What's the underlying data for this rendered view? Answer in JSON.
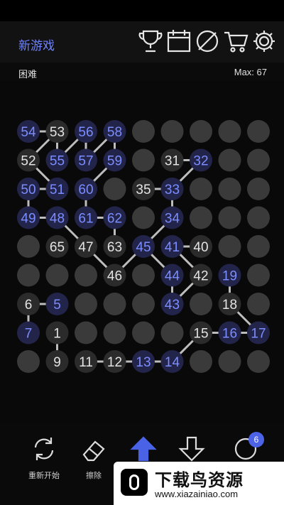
{
  "header": {
    "new_game": "新游戏",
    "icons": [
      "trophy-icon",
      "calendar-icon",
      "no-theme-icon",
      "cart-icon",
      "gear-icon"
    ]
  },
  "subheader": {
    "difficulty": "困难",
    "max": "Max: 67"
  },
  "board": {
    "rows": 9,
    "cols": 9,
    "colors": {
      "empty": "#3a3a3a",
      "given": "#2b2b2b",
      "placed": "#23244a",
      "given_text": "#e4e4e4",
      "placed_text": "#7b8dff",
      "line": "#bdbdbd"
    },
    "cells": [
      {
        "r": 0,
        "c": 0,
        "n": "54",
        "t": "p"
      },
      {
        "r": 0,
        "c": 1,
        "n": "53",
        "t": "g"
      },
      {
        "r": 0,
        "c": 2,
        "n": "56",
        "t": "p"
      },
      {
        "r": 0,
        "c": 3,
        "n": "58",
        "t": "p"
      },
      {
        "r": 1,
        "c": 0,
        "n": "52",
        "t": "g"
      },
      {
        "r": 1,
        "c": 1,
        "n": "55",
        "t": "p"
      },
      {
        "r": 1,
        "c": 2,
        "n": "57",
        "t": "p"
      },
      {
        "r": 1,
        "c": 3,
        "n": "59",
        "t": "p"
      },
      {
        "r": 1,
        "c": 5,
        "n": "31",
        "t": "g"
      },
      {
        "r": 1,
        "c": 6,
        "n": "32",
        "t": "p"
      },
      {
        "r": 2,
        "c": 0,
        "n": "50",
        "t": "p"
      },
      {
        "r": 2,
        "c": 1,
        "n": "51",
        "t": "p"
      },
      {
        "r": 2,
        "c": 2,
        "n": "60",
        "t": "p"
      },
      {
        "r": 2,
        "c": 4,
        "n": "35",
        "t": "g"
      },
      {
        "r": 2,
        "c": 5,
        "n": "33",
        "t": "p"
      },
      {
        "r": 3,
        "c": 0,
        "n": "49",
        "t": "p"
      },
      {
        "r": 3,
        "c": 1,
        "n": "48",
        "t": "p"
      },
      {
        "r": 3,
        "c": 2,
        "n": "61",
        "t": "p"
      },
      {
        "r": 3,
        "c": 3,
        "n": "62",
        "t": "p"
      },
      {
        "r": 3,
        "c": 5,
        "n": "34",
        "t": "p"
      },
      {
        "r": 4,
        "c": 1,
        "n": "65",
        "t": "g"
      },
      {
        "r": 4,
        "c": 2,
        "n": "47",
        "t": "g"
      },
      {
        "r": 4,
        "c": 3,
        "n": "63",
        "t": "g"
      },
      {
        "r": 4,
        "c": 4,
        "n": "45",
        "t": "p"
      },
      {
        "r": 4,
        "c": 5,
        "n": "41",
        "t": "p"
      },
      {
        "r": 4,
        "c": 6,
        "n": "40",
        "t": "g"
      },
      {
        "r": 5,
        "c": 3,
        "n": "46",
        "t": "g"
      },
      {
        "r": 5,
        "c": 5,
        "n": "44",
        "t": "p"
      },
      {
        "r": 5,
        "c": 6,
        "n": "42",
        "t": "g"
      },
      {
        "r": 5,
        "c": 7,
        "n": "19",
        "t": "p"
      },
      {
        "r": 6,
        "c": 0,
        "n": "6",
        "t": "g"
      },
      {
        "r": 6,
        "c": 1,
        "n": "5",
        "t": "p"
      },
      {
        "r": 6,
        "c": 5,
        "n": "43",
        "t": "p"
      },
      {
        "r": 6,
        "c": 7,
        "n": "18",
        "t": "g"
      },
      {
        "r": 7,
        "c": 0,
        "n": "7",
        "t": "p"
      },
      {
        "r": 7,
        "c": 1,
        "n": "1",
        "t": "g"
      },
      {
        "r": 7,
        "c": 6,
        "n": "15",
        "t": "g"
      },
      {
        "r": 7,
        "c": 7,
        "n": "16",
        "t": "p"
      },
      {
        "r": 7,
        "c": 8,
        "n": "17",
        "t": "p"
      },
      {
        "r": 8,
        "c": 1,
        "n": "9",
        "t": "g"
      },
      {
        "r": 8,
        "c": 2,
        "n": "11",
        "t": "g"
      },
      {
        "r": 8,
        "c": 3,
        "n": "12",
        "t": "g"
      },
      {
        "r": 8,
        "c": 4,
        "n": "13",
        "t": "p"
      },
      {
        "r": 8,
        "c": 5,
        "n": "14",
        "t": "p"
      }
    ],
    "links": [
      [
        "54",
        "53"
      ],
      [
        "53",
        "52"
      ],
      [
        "52",
        "51"
      ],
      [
        "51",
        "50"
      ],
      [
        "50",
        "49"
      ],
      [
        "49",
        "48"
      ],
      [
        "48",
        "47"
      ],
      [
        "47",
        "46"
      ],
      [
        "46",
        "45"
      ],
      [
        "45",
        "44"
      ],
      [
        "44",
        "43"
      ],
      [
        "43",
        "42"
      ],
      [
        "42",
        "41"
      ],
      [
        "41",
        "40"
      ],
      [
        "53",
        "55"
      ],
      [
        "55",
        "56"
      ],
      [
        "56",
        "57"
      ],
      [
        "57",
        "58"
      ],
      [
        "58",
        "59"
      ],
      [
        "59",
        "60"
      ],
      [
        "60",
        "61"
      ],
      [
        "61",
        "62"
      ],
      [
        "62",
        "63"
      ],
      [
        "31",
        "32"
      ],
      [
        "32",
        "33"
      ],
      [
        "33",
        "34"
      ],
      [
        "33",
        "35"
      ],
      [
        "34",
        "45"
      ],
      [
        "6",
        "5"
      ],
      [
        "6",
        "7"
      ],
      [
        "1",
        "9"
      ],
      [
        "11",
        "12"
      ],
      [
        "12",
        "13"
      ],
      [
        "13",
        "14"
      ],
      [
        "14",
        "15"
      ],
      [
        "15",
        "16"
      ],
      [
        "16",
        "17"
      ],
      [
        "17",
        "18"
      ],
      [
        "18",
        "19"
      ]
    ]
  },
  "toolbar": {
    "restart_label": "重新开始",
    "erase_label": "擦除",
    "hint_count": "6"
  },
  "brand": {
    "name": "下载鸟资源",
    "url": "www.xiazainiao.com"
  }
}
